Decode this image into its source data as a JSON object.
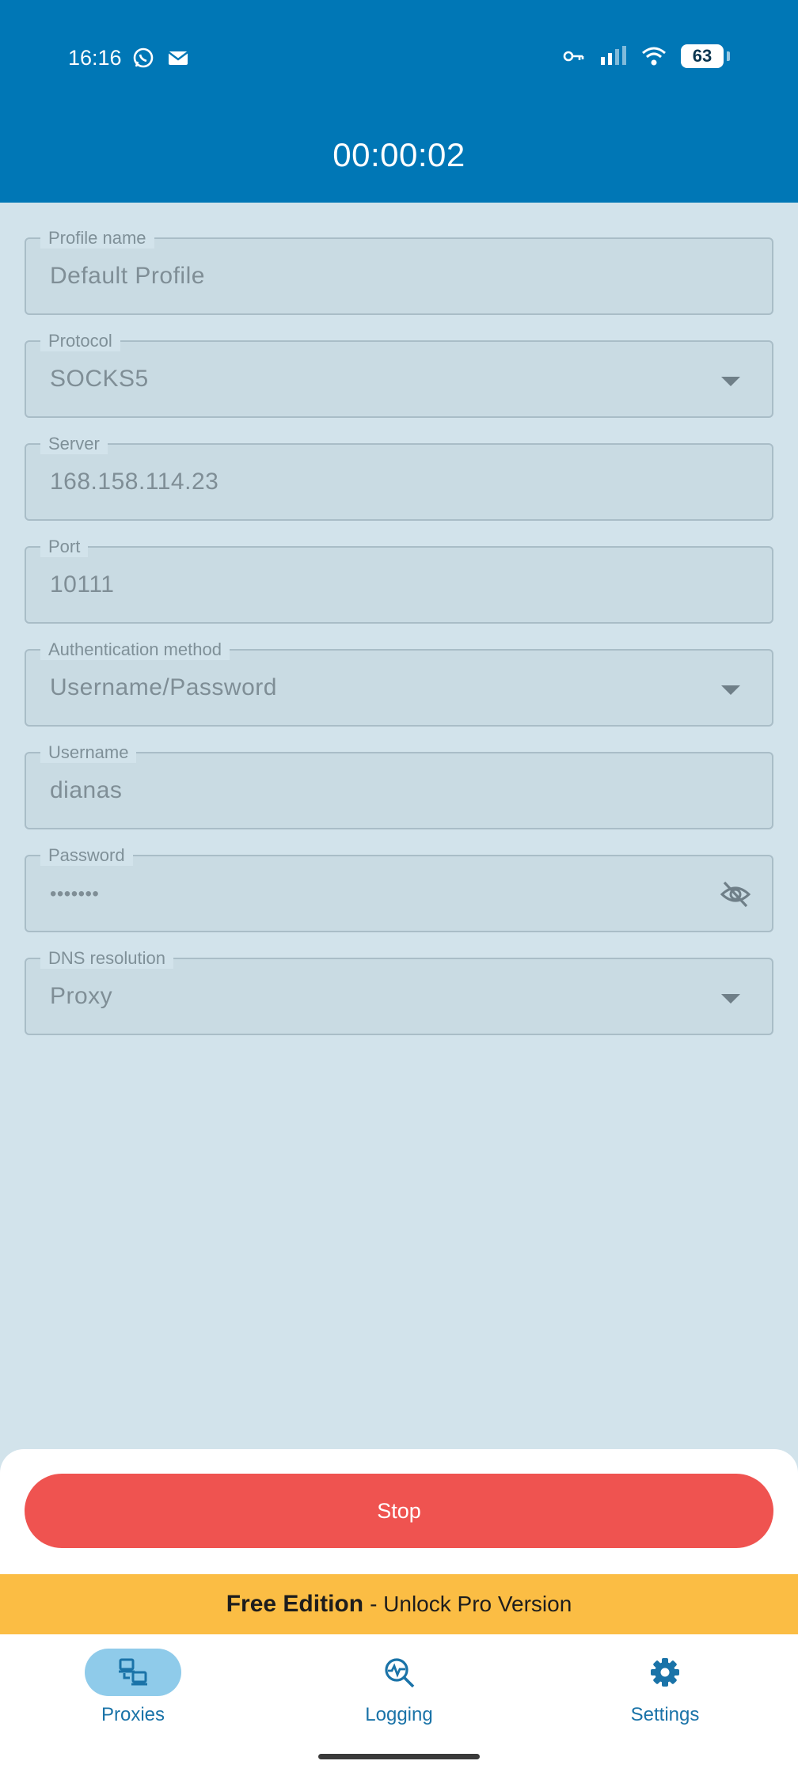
{
  "status_bar": {
    "time": "16:16",
    "battery": "63"
  },
  "header": {
    "timer": "00:00:02"
  },
  "form": {
    "profile_name": {
      "label": "Profile name",
      "value": "Default Profile"
    },
    "protocol": {
      "label": "Protocol",
      "value": "SOCKS5"
    },
    "server": {
      "label": "Server",
      "value": "168.158.114.23"
    },
    "port": {
      "label": "Port",
      "value": "10111"
    },
    "auth_method": {
      "label": "Authentication method",
      "value": "Username/Password"
    },
    "username": {
      "label": "Username",
      "value": "dianas"
    },
    "password": {
      "label": "Password",
      "value": "•••••••"
    },
    "dns": {
      "label": "DNS resolution",
      "value": "Proxy"
    }
  },
  "actions": {
    "stop_label": "Stop"
  },
  "promo": {
    "bold": "Free Edition",
    "rest": "- Unlock Pro Version"
  },
  "nav": {
    "items": [
      {
        "label": "Proxies",
        "icon": "proxies-icon",
        "active": true
      },
      {
        "label": "Logging",
        "icon": "logging-icon",
        "active": false
      },
      {
        "label": "Settings",
        "icon": "settings-icon",
        "active": false
      }
    ]
  },
  "colors": {
    "header": "#0077b6",
    "stop": "#ef5350",
    "promo": "#fbbd44",
    "nav_active": "#8fcbea"
  }
}
